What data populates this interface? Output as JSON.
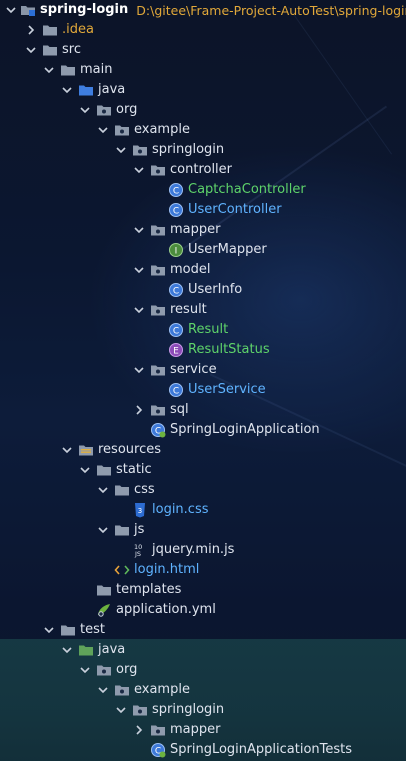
{
  "project": {
    "name": "spring-login",
    "path": "D:\\gitee\\Frame-Project-AutoTest\\spring-login"
  },
  "rows": [
    {
      "id": "idea",
      "label": ".idea",
      "indent": 1,
      "arrow": "right",
      "icon": "folder",
      "color": "gold"
    },
    {
      "id": "src",
      "label": "src",
      "indent": 1,
      "arrow": "down",
      "icon": "folder",
      "color": "white"
    },
    {
      "id": "main",
      "label": "main",
      "indent": 2,
      "arrow": "down",
      "icon": "folder",
      "color": "white"
    },
    {
      "id": "java-main",
      "label": "java",
      "indent": 3,
      "arrow": "down",
      "icon": "folder-blue",
      "color": "white"
    },
    {
      "id": "org",
      "label": "org",
      "indent": 4,
      "arrow": "down",
      "icon": "package",
      "color": "white"
    },
    {
      "id": "example",
      "label": "example",
      "indent": 5,
      "arrow": "down",
      "icon": "package",
      "color": "white"
    },
    {
      "id": "springlogin",
      "label": "springlogin",
      "indent": 6,
      "arrow": "down",
      "icon": "package",
      "color": "white"
    },
    {
      "id": "controller",
      "label": "controller",
      "indent": 7,
      "arrow": "down",
      "icon": "package",
      "color": "white"
    },
    {
      "id": "captcha-controller",
      "label": "CaptchaController",
      "indent": 8,
      "arrow": "none",
      "icon": "class",
      "color": "green"
    },
    {
      "id": "user-controller",
      "label": "UserController",
      "indent": 8,
      "arrow": "none",
      "icon": "class",
      "color": "blue"
    },
    {
      "id": "mapper",
      "label": "mapper",
      "indent": 7,
      "arrow": "down",
      "icon": "package",
      "color": "white"
    },
    {
      "id": "user-mapper",
      "label": "UserMapper",
      "indent": 8,
      "arrow": "none",
      "icon": "interface",
      "color": "white"
    },
    {
      "id": "model",
      "label": "model",
      "indent": 7,
      "arrow": "down",
      "icon": "package",
      "color": "white"
    },
    {
      "id": "user-info",
      "label": "UserInfo",
      "indent": 8,
      "arrow": "none",
      "icon": "class",
      "color": "white"
    },
    {
      "id": "result",
      "label": "result",
      "indent": 7,
      "arrow": "down",
      "icon": "package",
      "color": "white"
    },
    {
      "id": "result-class",
      "label": "Result",
      "indent": 8,
      "arrow": "none",
      "icon": "class",
      "color": "green"
    },
    {
      "id": "result-status",
      "label": "ResultStatus",
      "indent": 8,
      "arrow": "none",
      "icon": "enum",
      "color": "green"
    },
    {
      "id": "service",
      "label": "service",
      "indent": 7,
      "arrow": "down",
      "icon": "package",
      "color": "white"
    },
    {
      "id": "user-service",
      "label": "UserService",
      "indent": 8,
      "arrow": "none",
      "icon": "class",
      "color": "blue"
    },
    {
      "id": "sql",
      "label": "sql",
      "indent": 7,
      "arrow": "right",
      "icon": "package",
      "color": "white"
    },
    {
      "id": "spring-login-app",
      "label": "SpringLoginApplication",
      "indent": 7,
      "arrow": "none",
      "icon": "spring-class",
      "color": "white"
    },
    {
      "id": "resources",
      "label": "resources",
      "indent": 3,
      "arrow": "down",
      "icon": "folder-res",
      "color": "white"
    },
    {
      "id": "static",
      "label": "static",
      "indent": 4,
      "arrow": "down",
      "icon": "folder",
      "color": "white"
    },
    {
      "id": "css",
      "label": "css",
      "indent": 5,
      "arrow": "down",
      "icon": "folder",
      "color": "white"
    },
    {
      "id": "login-css",
      "label": "login.css",
      "indent": 6,
      "arrow": "none",
      "icon": "css-file",
      "color": "blue"
    },
    {
      "id": "js",
      "label": "js",
      "indent": 5,
      "arrow": "down",
      "icon": "folder",
      "color": "white"
    },
    {
      "id": "jquery",
      "label": "jquery.min.js",
      "indent": 6,
      "arrow": "none",
      "icon": "js-file",
      "color": "white"
    },
    {
      "id": "login-html",
      "label": "login.html",
      "indent": 5,
      "arrow": "none",
      "icon": "html-file",
      "color": "blue"
    },
    {
      "id": "templates",
      "label": "templates",
      "indent": 4,
      "arrow": "none",
      "icon": "folder",
      "color": "white"
    },
    {
      "id": "application-yml",
      "label": "application.yml",
      "indent": 4,
      "arrow": "none",
      "icon": "yml-file",
      "color": "white"
    },
    {
      "id": "test",
      "label": "test",
      "indent": 2,
      "arrow": "down",
      "icon": "folder",
      "color": "white"
    },
    {
      "id": "java-test",
      "label": "java",
      "indent": 3,
      "arrow": "down",
      "icon": "folder-test",
      "color": "white"
    },
    {
      "id": "org-test",
      "label": "org",
      "indent": 4,
      "arrow": "down",
      "icon": "package",
      "color": "white"
    },
    {
      "id": "example-test",
      "label": "example",
      "indent": 5,
      "arrow": "down",
      "icon": "package",
      "color": "white"
    },
    {
      "id": "springlogin-test",
      "label": "springlogin",
      "indent": 6,
      "arrow": "down",
      "icon": "package",
      "color": "white"
    },
    {
      "id": "mapper-test",
      "label": "mapper",
      "indent": 7,
      "arrow": "right",
      "icon": "package",
      "color": "white"
    },
    {
      "id": "spring-login-app-tests",
      "label": "SpringLoginApplicationTests",
      "indent": 7,
      "arrow": "none",
      "icon": "spring-class",
      "color": "white"
    }
  ]
}
